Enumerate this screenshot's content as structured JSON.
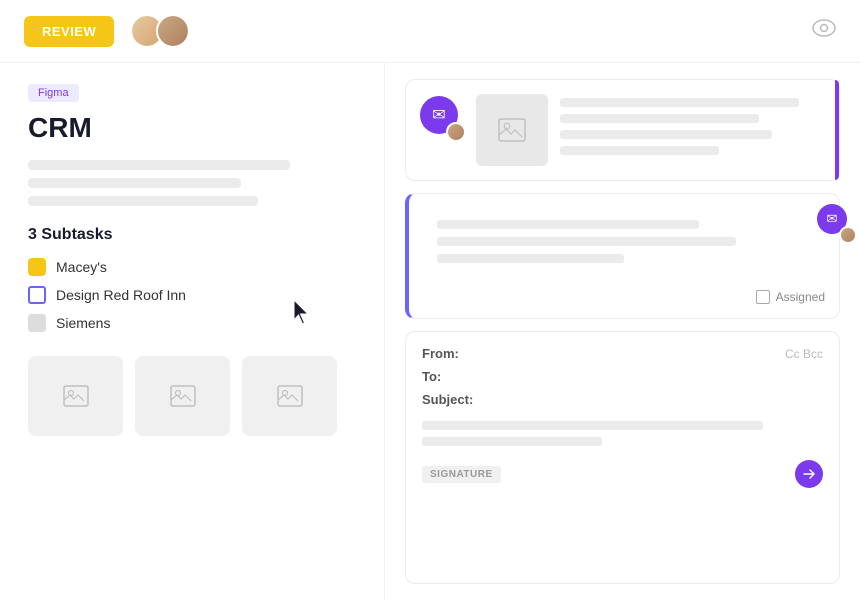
{
  "topbar": {
    "review_label": "REVIEW",
    "eye_label": "👁"
  },
  "left": {
    "badge": "Figma",
    "title": "CRM",
    "subtasks_heading": "3 Subtasks",
    "subtasks": [
      {
        "label": "Macey's",
        "icon": "yellow"
      },
      {
        "label": "Design Red Roof Inn",
        "icon": "blue-outline"
      },
      {
        "label": "Siemens",
        "icon": "gray"
      }
    ]
  },
  "right": {
    "assigned_label": "Assigned",
    "email": {
      "from_label": "From:",
      "to_label": "To:",
      "subject_label": "Subject:",
      "cc_bcc": "Cc Bcc",
      "signature_label": "SIGNATURE"
    }
  }
}
